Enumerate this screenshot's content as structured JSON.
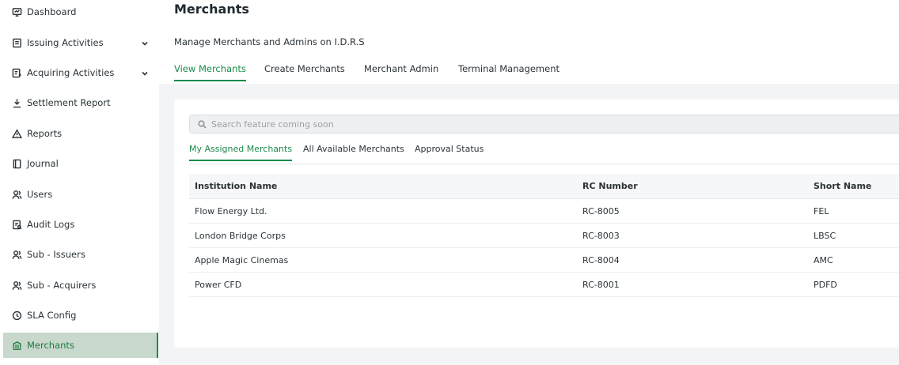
{
  "sidebar": {
    "items": [
      {
        "label": "Dashboard",
        "icon": "dashboard-icon"
      },
      {
        "label": "Issuing Activities",
        "icon": "issuing-icon"
      },
      {
        "label": "Acquiring Activities",
        "icon": "acquiring-icon"
      },
      {
        "label": "Settlement Report",
        "icon": "download-icon"
      },
      {
        "label": "Reports",
        "icon": "warning-icon"
      },
      {
        "label": "Journal",
        "icon": "journal-icon"
      },
      {
        "label": "Users",
        "icon": "users-icon"
      },
      {
        "label": "Audit Logs",
        "icon": "audit-icon"
      },
      {
        "label": "Sub - Issuers",
        "icon": "users-icon"
      },
      {
        "label": "Sub - Acquirers",
        "icon": "users-icon"
      },
      {
        "label": "SLA Config",
        "icon": "clock-icon"
      },
      {
        "label": "Merchants",
        "icon": "bank-icon"
      }
    ],
    "active": "Merchants",
    "accent_color": "#1a8a4a",
    "active_bg": "#c8d8cc"
  },
  "header": {
    "title": "Merchants",
    "subtitle": "Manage Merchants and Admins on I.D.R.S",
    "tabs": [
      "View Merchants",
      "Create Merchants",
      "Merchant Admin",
      "Terminal Management"
    ],
    "active_tab": "View Merchants"
  },
  "search": {
    "placeholder": "Search feature coming soon"
  },
  "subtabs": {
    "items": [
      "My Assigned Merchants",
      "All Available Merchants",
      "Approval Status"
    ],
    "active": "My Assigned Merchants"
  },
  "table": {
    "columns": [
      "Institution Name",
      "RC Number",
      "Short Name"
    ],
    "rows": [
      [
        "Flow Energy Ltd.",
        "RC-8005",
        "FEL"
      ],
      [
        "London Bridge Corps",
        "RC-8003",
        "LBSC"
      ],
      [
        "Apple Magic Cinemas",
        "RC-8004",
        "AMC"
      ],
      [
        "Power CFD",
        "RC-8001",
        "PDFD"
      ]
    ]
  }
}
